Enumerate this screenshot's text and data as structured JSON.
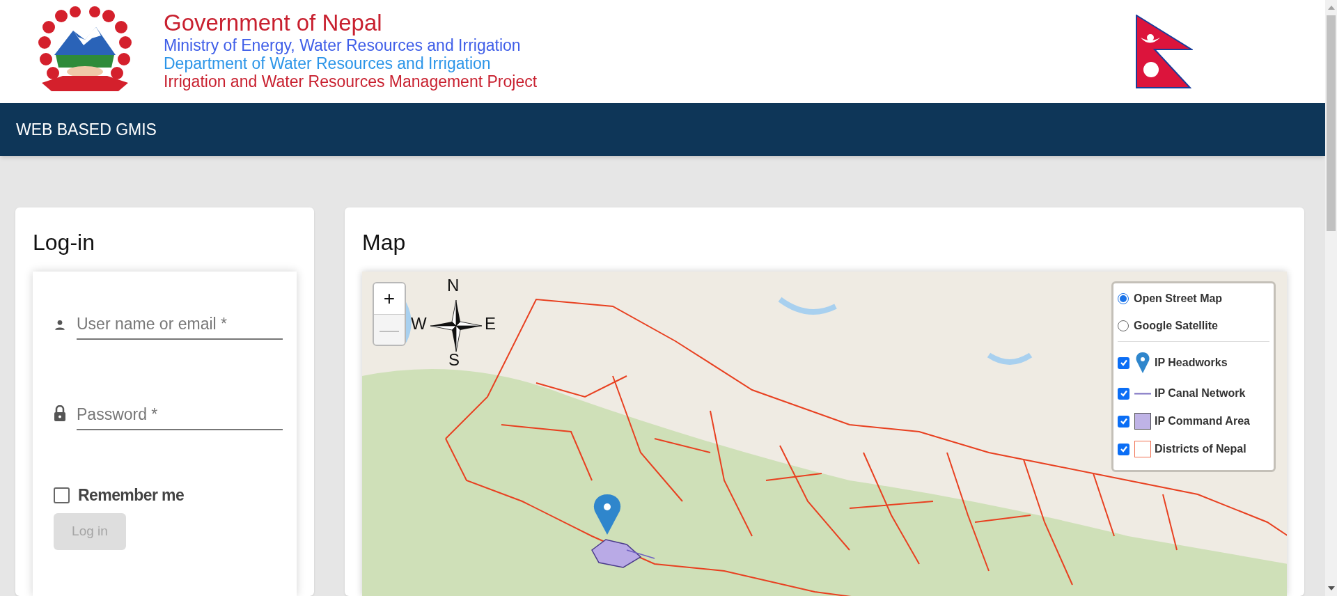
{
  "header": {
    "lines": [
      {
        "text": "Government of Nepal",
        "kind": "title",
        "color": "#c8202f"
      },
      {
        "text": "Ministry of Energy, Water Resources and Irrigation",
        "kind": "line",
        "color": "#3f5ee8"
      },
      {
        "text": "Department of Water Resources and Irrigation",
        "kind": "line",
        "color": "#2b95e8"
      },
      {
        "text": "Irrigation and Water Resources Management Project",
        "kind": "line",
        "color": "#c8202f"
      }
    ]
  },
  "navbar": {
    "title": "WEB BASED GMIS"
  },
  "login": {
    "title": "Log-in",
    "fields": [
      {
        "kind": "user",
        "placeholder": "User name or email *"
      },
      {
        "kind": "password",
        "placeholder": "Password *"
      }
    ],
    "remember": {
      "label": "Remember me",
      "checked": false
    },
    "button": {
      "label": "Log in",
      "disabled": true
    }
  },
  "map": {
    "title": "Map",
    "zoom": [
      {
        "label": "+",
        "disabled": false
      },
      {
        "label": "—",
        "disabled": true
      }
    ],
    "compass": {
      "n": "N",
      "e": "E",
      "s": "S",
      "w": "W"
    },
    "base_layers": [
      {
        "label": "Open Street Map",
        "selected": true
      },
      {
        "label": "Google Satellite",
        "selected": false
      }
    ],
    "overlays": [
      {
        "label": "IP Headworks",
        "kind": "marker",
        "checked": true
      },
      {
        "label": "IP Canal Network",
        "kind": "line",
        "checked": true
      },
      {
        "label": "IP Command Area",
        "kind": "polygon",
        "checked": true
      },
      {
        "label": "Districts of Nepal",
        "kind": "outline",
        "checked": true
      }
    ]
  }
}
